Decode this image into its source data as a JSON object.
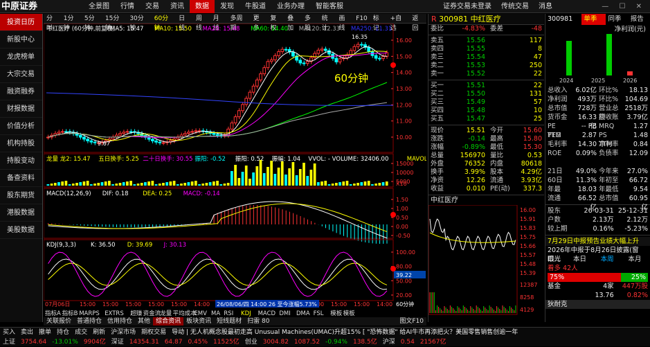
{
  "topbar": {
    "logo": "中原证券",
    "menu": [
      "全景图",
      "行情",
      "交易",
      "资讯",
      "数据",
      "发现",
      "牛股道",
      "业务办理",
      "智能客服"
    ],
    "active_menu": 4,
    "right": [
      "证券交易未登录",
      "传统交易",
      "消息"
    ]
  },
  "sidebar": {
    "items": [
      "投资日历",
      "新股中心",
      "龙虎榜单",
      "大宗交易",
      "融资融券",
      "财报数据",
      "价值分析",
      "机构持股",
      "持股变动",
      "备查资料",
      "股东期货",
      "港股数据",
      "美股数据"
    ],
    "active": 0
  },
  "chart_tabs": [
    "分时",
    "1分钟",
    "5分钟",
    "15分钟",
    "30分钟",
    "60分钟",
    "日线",
    "周线",
    "月线",
    "多周期",
    "更多",
    "复权",
    "叠加",
    "多股",
    "统计",
    "画线",
    "F10",
    "标记",
    "+自选",
    "返回"
  ],
  "chart_active_tab": 5,
  "main_chart": {
    "title": "中红医疗 (60分钟,前复权)",
    "ma_labels": [
      {
        "t": "MA5: 15.47",
        "c": "#ffffff"
      },
      {
        "t": "MA10: 15.50",
        "c": "#ffff00"
      },
      {
        "t": "MA20: 15.48",
        "c": "#ff00ff"
      },
      {
        "t": "MA60: 14.40",
        "c": "#00ff00"
      },
      {
        "t": "MA120: 12.33",
        "c": "#aaaaaa"
      },
      {
        "t": "MA250: 11.31",
        "c": "#3333ff"
      }
    ],
    "label_60": "60分钟",
    "high_label": "16.35",
    "low_label": "9.67",
    "yticks": [
      "16.00",
      "15.00",
      "14.00",
      "13.00",
      "12.00",
      "11.00",
      "10.00"
    ]
  },
  "vol_panel": {
    "labels": [
      {
        "t": "龙量 龙2: 15.47",
        "c": "#ffff00"
      },
      {
        "t": "五日换手: 5.25",
        "c": "#ffff00"
      },
      {
        "t": "二十日换手: 30.55",
        "c": "#ff00ff"
      },
      {
        "t": "振阳: -0.52",
        "c": "#00ffff"
      },
      {
        "t": "振阳: 0.52",
        "c": "#ffffff"
      },
      {
        "t": "振幅: 1.04",
        "c": "#ffffff"
      },
      {
        "t": "VVOL: - VOLUME: 32406.00",
        "c": "#ffffff"
      },
      {
        "t": "MAVOL",
        "c": "#ffff00"
      }
    ],
    "yticks": [
      "15000",
      "10000",
      "5000"
    ],
    "unit": "X10"
  },
  "macd_panel": {
    "labels": [
      {
        "t": "MACD(12,26,9)",
        "c": "#ffffff"
      },
      {
        "t": "DIF: 0.18",
        "c": "#ffffff"
      },
      {
        "t": "DEA: 0.25",
        "c": "#ffff00"
      },
      {
        "t": "MACD: -0.14",
        "c": "#ff00ff"
      }
    ],
    "yticks": [
      "1.50",
      "1.00",
      "0.50",
      "0.00",
      "-0.50"
    ]
  },
  "kdj_panel": {
    "labels": [
      {
        "t": "KDJ(9,3,3)",
        "c": "#ffffff"
      },
      {
        "t": "K: 36.50",
        "c": "#ffffff"
      },
      {
        "t": "D: 39.69",
        "c": "#ffff00"
      },
      {
        "t": "J: 30.13",
        "c": "#ff00ff"
      }
    ],
    "yticks": [
      "100.00",
      "80.00",
      "50.00",
      "20.00"
    ],
    "cur": "39.22"
  },
  "time_axis": {
    "left": "07月06日",
    "ticks": [
      "15:00",
      "15:00",
      "15:00",
      "15:00",
      "15:00",
      "14:00",
      "15:00",
      "15:00",
      "15:00",
      "15:00",
      "15:00",
      "15:00",
      "15:00",
      "14:00"
    ],
    "highlight": "26/08/06/四 14:00 26 至今涨幅5.73%",
    "right": "60分钟"
  },
  "bottom_tabs": [
    "指标A",
    "指标B",
    "MARPS",
    "EXTRS",
    "超赚",
    "资金流",
    "龙量",
    "平均成本",
    "EMV",
    "MA",
    "RSI",
    "KDJ",
    "MACD",
    "DMI",
    "DMA",
    "FSL",
    "模板",
    "模板"
  ],
  "quote": {
    "code": "300981",
    "name": "中红医疗",
    "weibi_label": "委比",
    "weibi": "-4.83%",
    "weicha_label": "委差",
    "weicha": "-48",
    "asks": [
      {
        "l": "卖五",
        "p": "15.56",
        "v": "117"
      },
      {
        "l": "卖四",
        "p": "15.55",
        "v": "8"
      },
      {
        "l": "卖三",
        "p": "15.54",
        "v": "47"
      },
      {
        "l": "卖二",
        "p": "15.53",
        "v": "250"
      },
      {
        "l": "卖一",
        "p": "15.52",
        "v": "22"
      }
    ],
    "bids": [
      {
        "l": "买一",
        "p": "15.51",
        "v": "22"
      },
      {
        "l": "买二",
        "p": "15.50",
        "v": "131"
      },
      {
        "l": "买三",
        "p": "15.49",
        "v": "57"
      },
      {
        "l": "买四",
        "p": "15.48",
        "v": "10"
      },
      {
        "l": "买五",
        "p": "15.47",
        "v": "25"
      }
    ],
    "stats": [
      [
        "现价",
        "15.51",
        "今开",
        "15.60"
      ],
      [
        "涨跌",
        "-0.14",
        "最高",
        "15.80"
      ],
      [
        "涨幅",
        "-0.89%",
        "最低",
        "15.30"
      ],
      [
        "总量",
        "156970",
        "量比",
        "0.53"
      ],
      [
        "外盘",
        "76352",
        "内盘",
        "80618"
      ],
      [
        "换手",
        "3.99%",
        "股本",
        "4.29亿"
      ],
      [
        "净资",
        "12.26",
        "流通",
        "3.93亿"
      ],
      [
        "收益",
        "0.010",
        "PE(动)",
        "337.3"
      ]
    ],
    "mini_title": "中红医疗",
    "mini_ticks": [
      "16.00",
      "15.91",
      "15.83",
      "15.75",
      "15.66",
      "15.57",
      "15.48",
      "15.39"
    ],
    "mini_vol": [
      "12387",
      "8258",
      "4129"
    ]
  },
  "right": {
    "code": "300981",
    "tabs": [
      "单季",
      "同季",
      "报告"
    ],
    "bar_title": "净利润(元)",
    "bar_years": [
      "2024",
      "2025",
      "2026"
    ],
    "rows": [
      [
        "总收入",
        "6.02亿",
        "环比%",
        "18.13"
      ],
      [
        "净利润",
        "493万",
        "环比%",
        "104.69"
      ],
      [
        "总市值",
        "728万",
        "营业总额",
        "2518万"
      ],
      [
        "货币金",
        "16.33亿",
        "应收账",
        "3.79亿"
      ],
      [
        "PE TTM",
        "-- PB",
        "MRQ",
        "1.27"
      ],
      [
        "PEG",
        "2.87",
        "PS TTM",
        "1.48"
      ],
      [
        "毛利率",
        "14.30",
        "净利率",
        "0.84"
      ],
      [
        "ROE",
        "0.09%",
        "负债率",
        "12.09"
      ],
      [
        "",
        "",
        "",
        ""
      ],
      [
        "21日",
        "49.0%",
        "今年来",
        "27.0%"
      ],
      [
        "60日",
        "11.3%",
        "年初至",
        "66.72"
      ],
      [
        "年最",
        "18.03",
        "年最低",
        "9.54"
      ],
      [
        "流通",
        "66.52亿",
        "总市值",
        "60.95亿"
      ]
    ],
    "holder": [
      [
        "股东",
        "26-03-31",
        "25-12-31"
      ],
      [
        "户数",
        "2.13万",
        "2.12万"
      ],
      [
        "较上期",
        "0.16%",
        "-5.23%"
      ]
    ],
    "news1": "7月29日中报预告业绩大幅上升",
    "news2": "2026年中报于8月26日披露(窗口...",
    "mood": "眼光",
    "mood_tabs": [
      "本日",
      "本周",
      "本月"
    ],
    "bull": "看多 42人",
    "bull_pct": "75%",
    "bear_pct": "25%",
    "extra": [
      [
        "基金",
        "4家",
        "447万股"
      ],
      [
        "",
        "13.76",
        "0.82%"
      ]
    ],
    "brand": "狄耐克"
  },
  "toolbar2": [
    "关联报价",
    "普通持仓",
    "信用持仓",
    "其他",
    "综合资讯",
    "板块资讯",
    "短线题材",
    "扫雷 80"
  ],
  "toolbar2_right": "图文F10",
  "ticker": {
    "line1": [
      "买入",
      "卖出",
      "撤单",
      "持仓",
      "成交",
      "刷新",
      "沪深市场",
      "期权交易"
    ],
    "news": "导动 | 无人机概念股最初走高 Unusual Machines(UMAC)升超15% [ \"恐怖数据\" 给AI牛市再添把火？美国零售销售创逾一年",
    "line2": [
      [
        "上证",
        "3754.64",
        "-13.01%",
        "9904亿"
      ],
      [
        "深证",
        "14354.31",
        "64.87",
        "0.45%",
        "11525亿"
      ],
      [
        "创业",
        "3004.82",
        "1087.52",
        "-0.94%",
        "138.5亿"
      ],
      [
        "沪深",
        "0.54",
        "21567亿"
      ]
    ]
  }
}
